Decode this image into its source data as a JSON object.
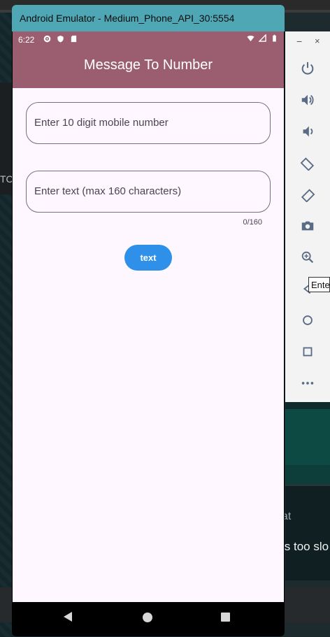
{
  "window": {
    "title": "Android Emulator - Medium_Phone_API_30:5554"
  },
  "status_bar": {
    "time": "6:22"
  },
  "app": {
    "title": "Message To Number",
    "phone_field": {
      "placeholder": "Enter 10 digit mobile number"
    },
    "text_field": {
      "placeholder": "Enter text (max 160 characters)",
      "counter": "0/160"
    },
    "send_button": {
      "label": "text"
    }
  },
  "toolbar": {
    "minimize": "−",
    "close": "×",
    "tooltip": "Ente"
  },
  "background": {
    "left_fragment": "TC",
    "right_fragment_1": "at",
    "right_fragment_2": "is too slo"
  },
  "colors": {
    "appbar": "#9b5e70",
    "titlebar": "#4fa7b5",
    "button": "#2f90ea",
    "page_bg": "#fef7ff"
  }
}
